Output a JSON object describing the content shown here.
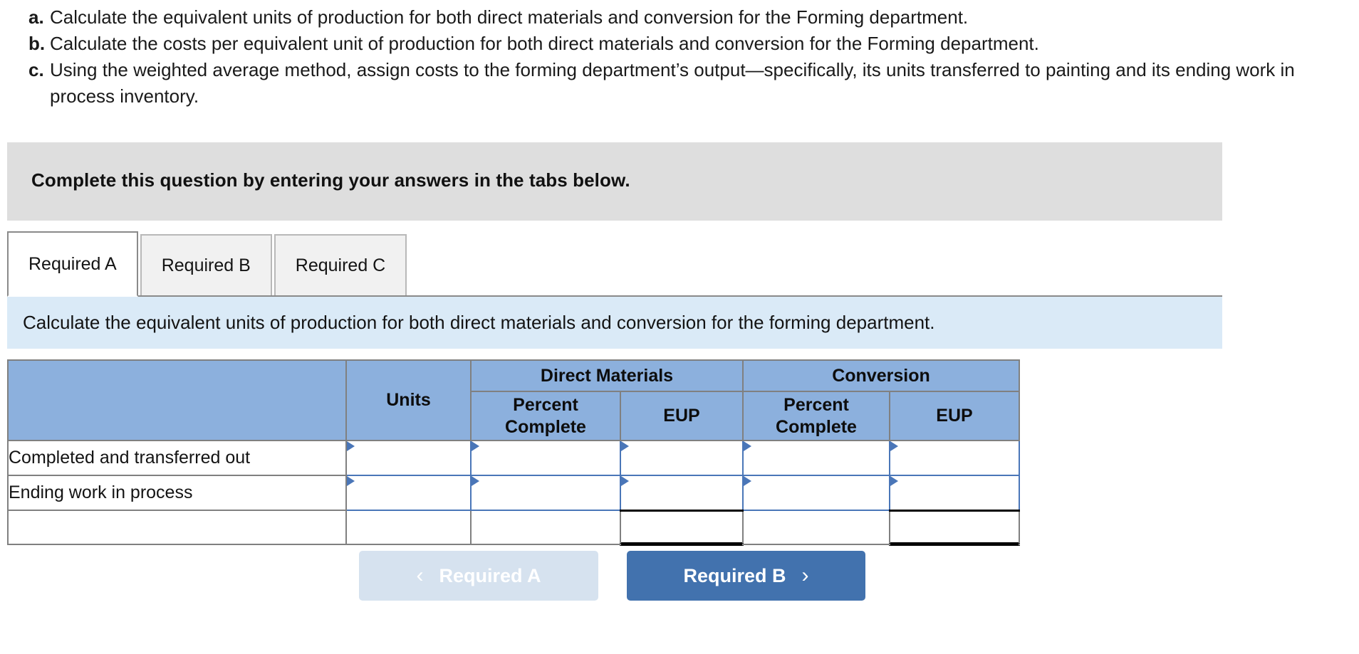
{
  "questions": [
    {
      "letter": "a.",
      "text": "Calculate the equivalent units of production for both direct materials and conversion for the Forming department."
    },
    {
      "letter": "b.",
      "text": "Calculate the costs per equivalent unit of production for both direct materials and conversion for the Forming department."
    },
    {
      "letter": "c.",
      "text": "Using the weighted average method, assign costs to the forming department’s output—specifically, its units transferred to painting and its ending work in process inventory."
    }
  ],
  "banner": {
    "text": "Complete this question by entering your answers in the tabs below."
  },
  "tabs": [
    {
      "label": "Required A",
      "active": true
    },
    {
      "label": "Required B",
      "active": false
    },
    {
      "label": "Required C",
      "active": false
    }
  ],
  "requirement_strip": {
    "text": "Calculate the equivalent units of production for both direct materials and conversion for the forming department."
  },
  "table": {
    "group_headers": {
      "blank": "",
      "units": "Units",
      "direct_materials": "Direct Materials",
      "conversion": "Conversion"
    },
    "sub_headers": {
      "dm_percent": "Percent Complete",
      "dm_eup": "EUP",
      "cv_percent": "Percent Complete",
      "cv_eup": "EUP"
    },
    "rows": [
      {
        "label": "Completed and transferred out",
        "units": "",
        "dm_percent": "",
        "dm_eup": "",
        "cv_percent": "",
        "cv_eup": "",
        "editable": true
      },
      {
        "label": "Ending work in process",
        "units": "",
        "dm_percent": "",
        "dm_eup": "",
        "cv_percent": "",
        "cv_eup": "",
        "editable": true
      },
      {
        "label": "",
        "units": "",
        "dm_percent": "",
        "dm_eup": "",
        "cv_percent": "",
        "cv_eup": "",
        "editable": false
      }
    ]
  },
  "footer": {
    "prev_label": "Required A",
    "prev_chevron": "‹",
    "next_label": "Required B",
    "next_chevron": "›"
  },
  "colors": {
    "header_blue": "#8cb0dd",
    "input_border_blue": "#4a76b8",
    "strip_blue": "#daeaf7",
    "banner_gray": "#dedede",
    "next_button_blue": "#4272ae",
    "prev_button_blue": "#d6e2ef"
  }
}
